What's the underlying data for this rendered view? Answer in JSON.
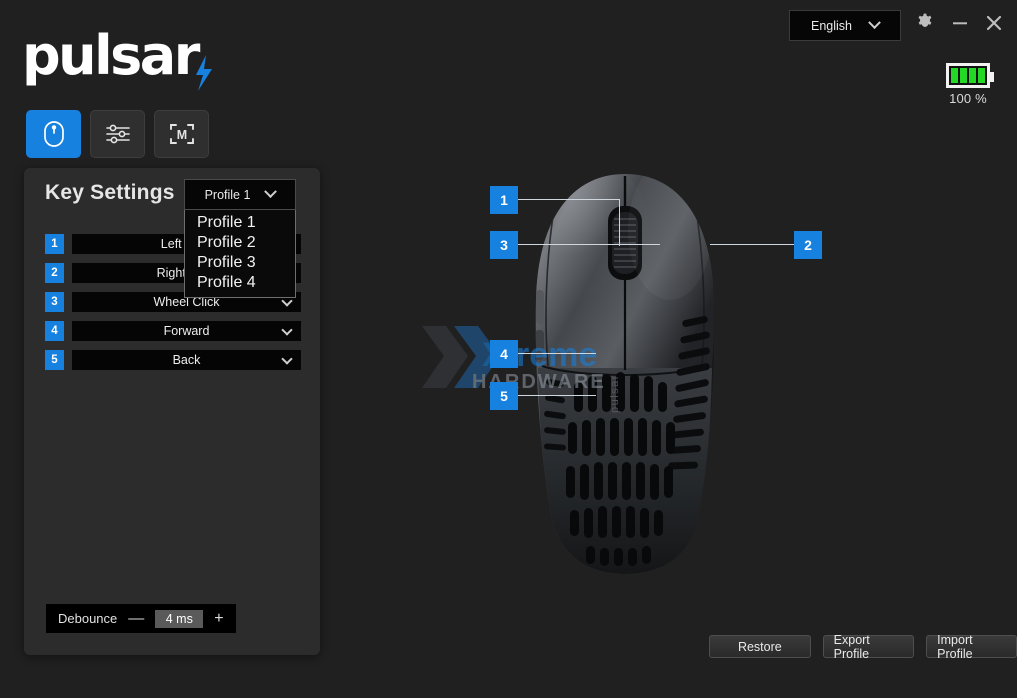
{
  "app": {
    "brand": "pulsar",
    "background_color": "#202020",
    "accent_color": "#1781e0"
  },
  "titlebar": {
    "language": {
      "selected": "English",
      "chevron_icon": "chevron-down-icon"
    },
    "settings_icon": "gear-icon",
    "minimize_icon": "minimize-icon",
    "close_icon": "close-icon"
  },
  "battery": {
    "percent_label": "100 %",
    "level": 100,
    "bars": 4,
    "color": "#23d926"
  },
  "tabs": [
    {
      "id": "mouse",
      "icon": "mouse-icon",
      "active": true
    },
    {
      "id": "performance",
      "icon": "sliders-icon",
      "active": false
    },
    {
      "id": "macro",
      "icon": "macro-bracket-m-icon",
      "label": "M",
      "active": false
    }
  ],
  "panel": {
    "title": "Key Settings",
    "profile": {
      "selected": "Profile 1",
      "chevron_icon": "chevron-down-icon",
      "open": true,
      "options": [
        "Profile 1",
        "Profile 2",
        "Profile 3",
        "Profile 4"
      ]
    },
    "keys": [
      {
        "number": "1",
        "binding": "Left Click"
      },
      {
        "number": "2",
        "binding": "Right Click"
      },
      {
        "number": "3",
        "binding": "Wheel Click"
      },
      {
        "number": "4",
        "binding": "Forward"
      },
      {
        "number": "5",
        "binding": "Back"
      }
    ],
    "debounce": {
      "label": "Debounce",
      "minus": "—",
      "value": "4 ms",
      "plus": "+"
    }
  },
  "diagram": {
    "callouts": [
      {
        "number": "1"
      },
      {
        "number": "2"
      },
      {
        "number": "3"
      },
      {
        "number": "4"
      },
      {
        "number": "5"
      }
    ],
    "watermark": {
      "line1": "Xtreme",
      "line2": "HARDWARE"
    }
  },
  "actions": {
    "restore": "Restore",
    "export_profile": "Export Profile",
    "import_profile": "Import Profile"
  }
}
